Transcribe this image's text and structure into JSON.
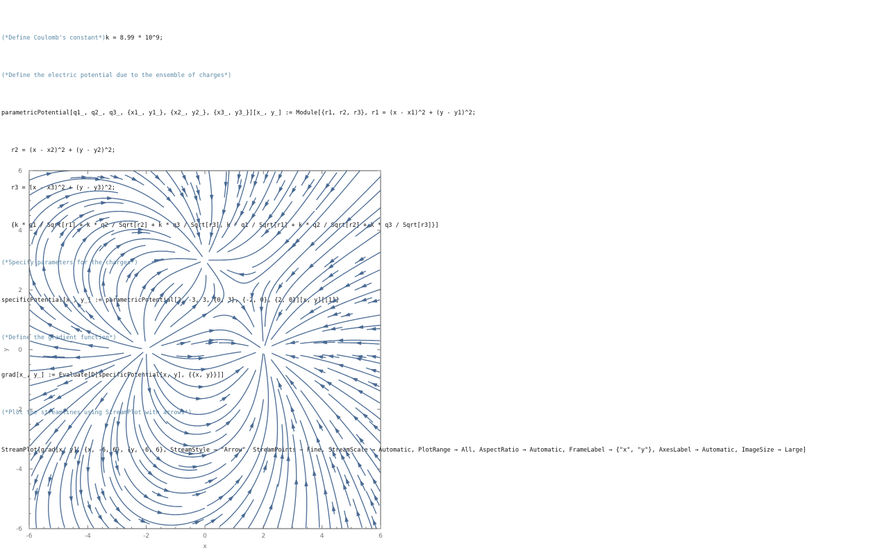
{
  "notebook": {
    "lines": [
      {
        "id": "c1",
        "comment": "(*Define Coulomb's constant*)",
        "code": "k = 8.99 * 10^9;"
      },
      {
        "id": "c2",
        "comment": "(*Define the electric potential due to the ensemble of charges*)",
        "code": ""
      },
      {
        "id": "l1",
        "comment": "",
        "code": "parametricPotential[q1_, q2_, q3_, {x1_, y1_}, {x2_, y2_}, {x3_, y3_}][x_, y_] := Module[{r1, r2, r3}, r1 = (x - x1)^2 + (y - y1)^2;"
      },
      {
        "id": "l2",
        "comment": "",
        "code": "r2 = (x - x2)^2 + (y - y2)^2;"
      },
      {
        "id": "l3",
        "comment": "",
        "code": "r3 = (x - x3)^2 + (y - y3)^2;"
      },
      {
        "id": "l4",
        "comment": "",
        "code": "{k * q1 / Sqrt[r1] + k * q2 / Sqrt[r2] + k * q3 / Sqrt[r3], k * q1 / Sqrt[r1] + k * q2 / Sqrt[r2] + k * q3 / Sqrt[r3]}]"
      },
      {
        "id": "c3",
        "comment": "(*Specify parameters for the charges*)",
        "code": ""
      },
      {
        "id": "l5",
        "comment": "",
        "code": "specificPotential[x_, y_] := parametricPotential[2, -3, 3, {0, 3}, {-2, 0}, {2, 0}][x, y][[1]]"
      },
      {
        "id": "c4",
        "comment": "(*Define the gradient function*)",
        "code": ""
      },
      {
        "id": "l6",
        "comment": "",
        "code": "grad[x_, y_] := Evaluate[D[specificPotential[x, y], {{x, y}}]]"
      },
      {
        "id": "c5",
        "comment": "(*Plot the streamlines using StreamPlot with arrows*)",
        "code": ""
      },
      {
        "id": "l7",
        "comment": "",
        "code": "StreamPlot[grad[x, y], {x, -6, 6}, {y, -6, 6}, StreamStyle → \"Arrow\", StreamPoints → Fine, StreamScale → Automatic, PlotRange → All, AspectRatio → Automatic, FrameLabel → {\"x\", \"y\"}, AxesLabel → Automatic, ImageSize → Large]"
      }
    ]
  },
  "chart_data": {
    "type": "streamplot",
    "xlabel": "x",
    "ylabel": "y",
    "xlim": [
      -6,
      6
    ],
    "ylim": [
      -6,
      6
    ],
    "xticks": [
      "-6",
      "-4",
      "-2",
      "0",
      "2",
      "4",
      "6"
    ],
    "yticks": [
      "6",
      "4",
      "2",
      "0",
      "-2",
      "-4",
      "-6"
    ],
    "charges": [
      {
        "q": 2,
        "x": 0,
        "y": 3
      },
      {
        "q": -3,
        "x": -2,
        "y": 0
      },
      {
        "q": 3,
        "x": 2,
        "y": 0
      }
    ],
    "line_color": "#4a6b94",
    "frame_color": "#555555",
    "tick_color": "#777777"
  }
}
